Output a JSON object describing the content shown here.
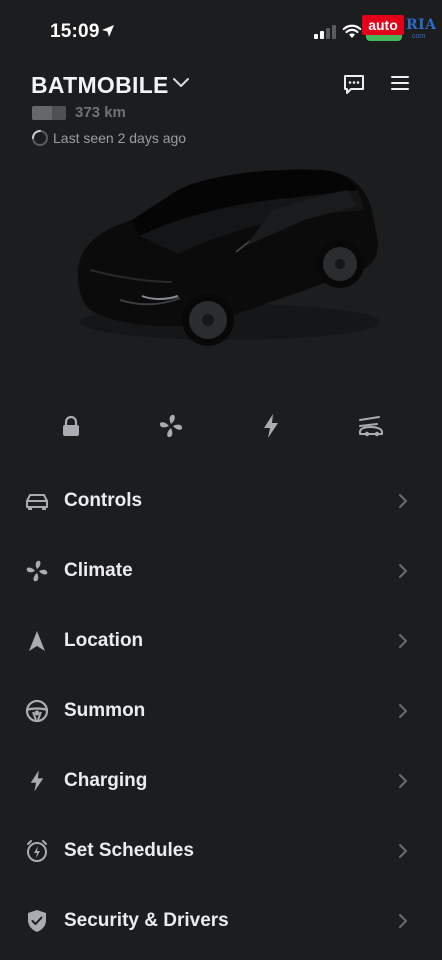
{
  "status_bar": {
    "time": "15:09",
    "watermark": {
      "brand_left": "auto",
      "brand_right": "RIA",
      "domain": ".com"
    }
  },
  "vehicle": {
    "name": "BATMOBILE",
    "range": "373 km",
    "battery_level_fraction": 0.6,
    "last_seen": "Last seen 2 days ago"
  },
  "quick_actions": [
    {
      "icon": "lock-icon"
    },
    {
      "icon": "fan-icon"
    },
    {
      "icon": "lightning-icon"
    },
    {
      "icon": "frunk-icon"
    }
  ],
  "menu": {
    "items": [
      {
        "label": "Controls",
        "icon": "car-icon"
      },
      {
        "label": "Climate",
        "icon": "fan-icon"
      },
      {
        "label": "Location",
        "icon": "navigation-arrow-icon"
      },
      {
        "label": "Summon",
        "icon": "steering-wheel-icon"
      },
      {
        "label": "Charging",
        "icon": "lightning-icon"
      },
      {
        "label": "Set Schedules",
        "icon": "alarm-clock-icon"
      },
      {
        "label": "Security & Drivers",
        "icon": "shield-check-icon"
      }
    ]
  },
  "colors": {
    "background": "#1c1d1f",
    "text_primary": "#ebecef",
    "text_secondary": "#9a9ea2",
    "icon_gray": "#a9acb0",
    "battery_green": "#47b85a"
  }
}
